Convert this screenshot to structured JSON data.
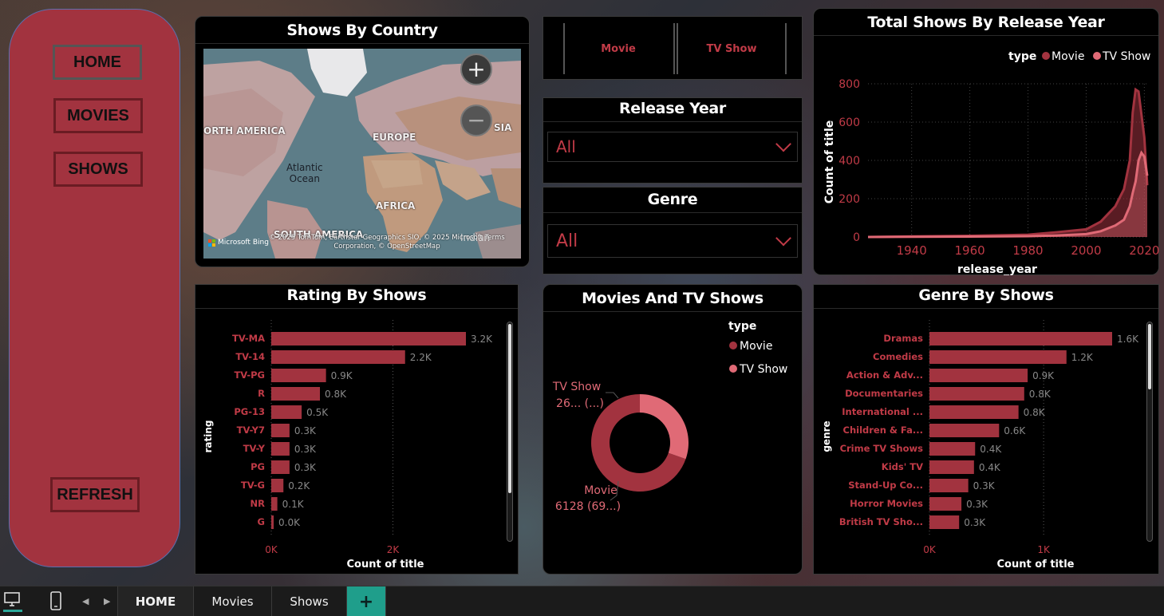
{
  "nav": {
    "home": "HOME",
    "movies": "MOVIES",
    "shows": "SHOWS",
    "refresh": "REFRESH"
  },
  "map_panel": {
    "title": "Shows By Country",
    "labels": {
      "north_america": "ORTH AMERICA",
      "europe": "EUROPE",
      "asia": "SIA",
      "atlantic": "Atlantic\nOcean",
      "africa": "AFRICA",
      "south_america": "SOUTH AMERICA",
      "indian": "Indian"
    },
    "attribution": "© 2025 TomTom, Earthstar Geographics SIO, © 2025 Microsoft  Terms\nCorporation, © OpenStreetMap",
    "bing": "Microsoft Bing",
    "zoom_in": "+",
    "zoom_out": "−"
  },
  "type_slicer": {
    "options": [
      "Movie",
      "TV Show"
    ]
  },
  "release_slicer": {
    "title": "Release Year",
    "value": "All"
  },
  "genre_slicer": {
    "title": "Genre",
    "value": "All"
  },
  "colors": {
    "accent": "#a2333f",
    "movie": "#a2333f",
    "tv": "#e06a76",
    "panel": "#000000"
  },
  "charts": {
    "year": {
      "title": "Total Shows By Release Year",
      "legend_title": "type",
      "legend": [
        "Movie",
        "TV Show"
      ],
      "xlabel": "release_year",
      "ylabel": "Count of title",
      "xticks": [
        "1940",
        "1960",
        "1980",
        "2000",
        "2020"
      ],
      "yticks": [
        "800",
        "600",
        "400",
        "200",
        "0"
      ]
    },
    "rating": {
      "title": "Rating By Shows",
      "ylabel": "rating",
      "xlabel": "Count of title",
      "xticks": [
        "0K",
        "2K"
      ]
    },
    "donut": {
      "title": "Movies And TV Shows",
      "legend_title": "type",
      "legend": [
        "Movie",
        "TV Show"
      ],
      "label_tv_1": "TV Show",
      "label_tv_2": "26... (...)",
      "label_movie_1": "Movie",
      "label_movie_2": "6128 (69...)"
    },
    "genre": {
      "title": "Genre By Shows",
      "ylabel": "genre",
      "xlabel": "Count of title",
      "xticks": [
        "0K",
        "1K"
      ]
    }
  },
  "chart_data": [
    {
      "type": "area",
      "title": "Total Shows By Release Year",
      "xlabel": "release_year",
      "ylabel": "Count of title",
      "xlim": [
        1925,
        2021
      ],
      "ylim": [
        0,
        800
      ],
      "grid": true,
      "legend": "top-right",
      "series": [
        {
          "name": "Movie",
          "x": [
            1925,
            1940,
            1960,
            1980,
            1990,
            2000,
            2005,
            2010,
            2013,
            2015,
            2016,
            2017,
            2018,
            2019,
            2020,
            2021
          ],
          "values": [
            0,
            3,
            6,
            12,
            25,
            40,
            80,
            160,
            250,
            400,
            650,
            770,
            760,
            640,
            520,
            270
          ]
        },
        {
          "name": "TV Show",
          "x": [
            1925,
            1940,
            1960,
            1980,
            1990,
            2000,
            2005,
            2010,
            2013,
            2015,
            2016,
            2017,
            2018,
            2019,
            2020,
            2021
          ],
          "values": [
            0,
            1,
            2,
            4,
            8,
            15,
            30,
            60,
            90,
            160,
            230,
            290,
            400,
            440,
            420,
            320
          ]
        }
      ]
    },
    {
      "type": "bar",
      "title": "Rating By Shows",
      "xlabel": "Count of title",
      "ylabel": "rating",
      "categories": [
        "TV-MA",
        "TV-14",
        "TV-PG",
        "R",
        "PG-13",
        "TV-Y7",
        "TV-Y",
        "PG",
        "TV-G",
        "NR",
        "G"
      ],
      "values": [
        3200,
        2200,
        900,
        800,
        500,
        300,
        300,
        300,
        200,
        100,
        40
      ],
      "labels": [
        "3.2K",
        "2.2K",
        "0.9K",
        "0.8K",
        "0.5K",
        "0.3K",
        "0.3K",
        "0.3K",
        "0.2K",
        "0.1K",
        "0.0K"
      ],
      "xlim": [
        0,
        3200
      ]
    },
    {
      "type": "pie",
      "title": "Movies And TV Shows",
      "categories": [
        "Movie",
        "TV Show"
      ],
      "values": [
        6128,
        2676
      ]
    },
    {
      "type": "bar",
      "title": "Genre By Shows",
      "xlabel": "Count of title",
      "ylabel": "genre",
      "categories": [
        "Dramas",
        "Comedies",
        "Action & Adv...",
        "Documentaries",
        "International ...",
        "Children & Fa...",
        "Crime TV Shows",
        "Kids' TV",
        "Stand-Up Co...",
        "Horror Movies",
        "British TV Sho..."
      ],
      "values": [
        1600,
        1200,
        860,
        830,
        780,
        610,
        400,
        390,
        340,
        280,
        260
      ],
      "labels": [
        "1.6K",
        "1.2K",
        "0.9K",
        "0.8K",
        "0.8K",
        "0.6K",
        "0.4K",
        "0.4K",
        "0.3K",
        "0.3K",
        "0.3K"
      ],
      "xlim": [
        0,
        1600
      ]
    }
  ],
  "taskbar": {
    "tabs": [
      "HOME",
      "Movies",
      "Shows"
    ],
    "add": "+"
  }
}
